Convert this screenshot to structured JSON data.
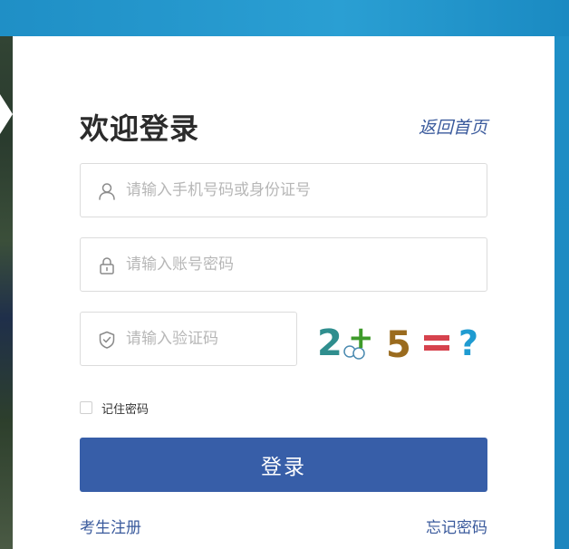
{
  "login": {
    "title": "欢迎登录",
    "home_link": "返回首页",
    "username_placeholder": "请输入手机号码或身份证号",
    "password_placeholder": "请输入账号密码",
    "captcha_placeholder": "请输入验证码",
    "captcha_text": "2+5=?",
    "remember_label": "记住密码",
    "submit_label": "登录",
    "register_link": "考生注册",
    "forgot_link": "忘记密码"
  },
  "icons": {
    "username": "user-icon",
    "password": "lock-icon",
    "captcha": "shield-icon"
  },
  "colors": {
    "accent": "#375ea8",
    "link": "#3a5a9c",
    "background": "#1f95c8"
  }
}
